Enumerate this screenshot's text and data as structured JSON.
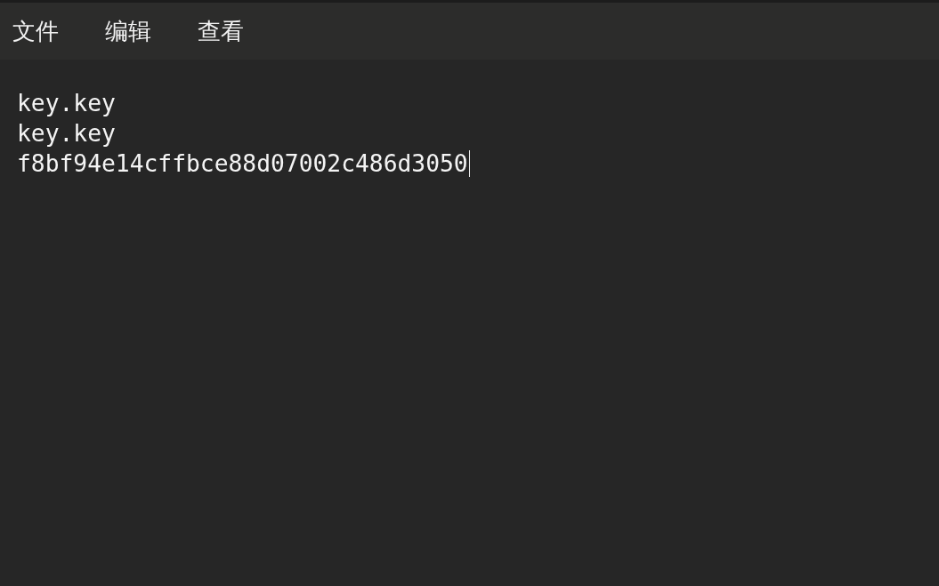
{
  "menu_bar": {
    "items": [
      {
        "label": "文件"
      },
      {
        "label": "编辑"
      },
      {
        "label": "查看"
      }
    ]
  },
  "editor": {
    "lines": [
      "key.key",
      "key.key",
      "f8bf94e14cffbce88d07002c486d3050"
    ]
  }
}
